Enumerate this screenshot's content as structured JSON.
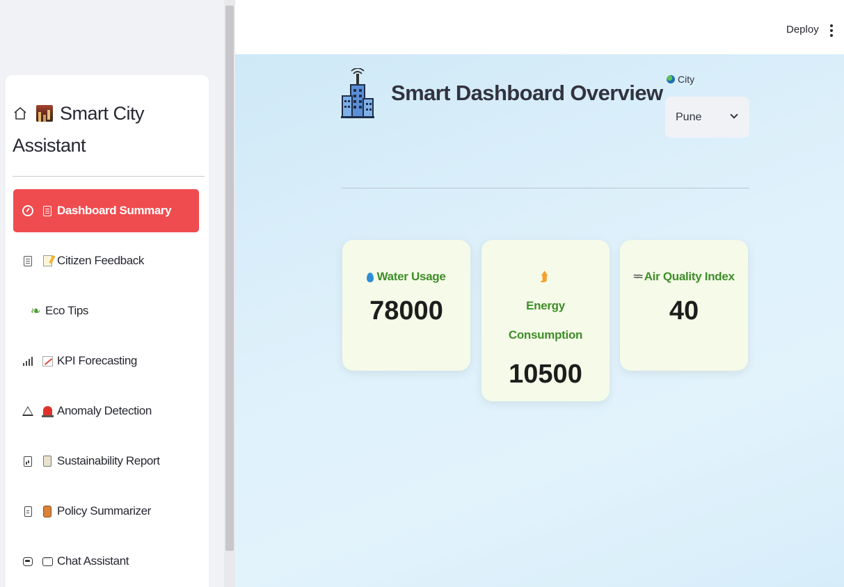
{
  "sidebar": {
    "brand_title": "Smart City Assistant",
    "nav": [
      {
        "label": "Dashboard Summary",
        "active": true,
        "icon1": "gauge-icon",
        "icon2": "clipboard-icon"
      },
      {
        "label": "Citizen Feedback",
        "active": false,
        "icon1": "message-icon",
        "icon2": "memo-icon"
      },
      {
        "label": "Eco Tips",
        "active": false,
        "icon1": "",
        "icon2": "seedling-icon"
      },
      {
        "label": "KPI Forecasting",
        "active": false,
        "icon1": "bar-chart-icon",
        "icon2": "chart-increasing-icon"
      },
      {
        "label": "Anomaly Detection",
        "active": false,
        "icon1": "warning-icon",
        "icon2": "siren-icon"
      },
      {
        "label": "Sustainability Report",
        "active": false,
        "icon1": "report-icon",
        "icon2": "scroll-icon"
      },
      {
        "label": "Policy Summarizer",
        "active": false,
        "icon1": "document-icon",
        "icon2": "scroll-icon"
      },
      {
        "label": "Chat Assistant",
        "active": false,
        "icon1": "robot-icon",
        "icon2": "speech-bubble-icon"
      }
    ]
  },
  "header": {
    "deploy_label": "Deploy"
  },
  "main": {
    "title": "Smart Dashboard Overview",
    "city_label": "City",
    "city_selected": "Pune",
    "cards": [
      {
        "label": "Water Usage",
        "value": "78000",
        "icon": "droplet-icon"
      },
      {
        "label": "Energy Consumption",
        "value": "10500",
        "icon": "lightning-icon"
      },
      {
        "label": "Air Quality Index",
        "value": "40",
        "icon": "wind-icon"
      }
    ]
  },
  "colors": {
    "active_nav": "#ef4c4f",
    "card_bg": "#f5fbe8",
    "card_label": "#3f8d2a",
    "main_bg": "#d9eef9"
  }
}
